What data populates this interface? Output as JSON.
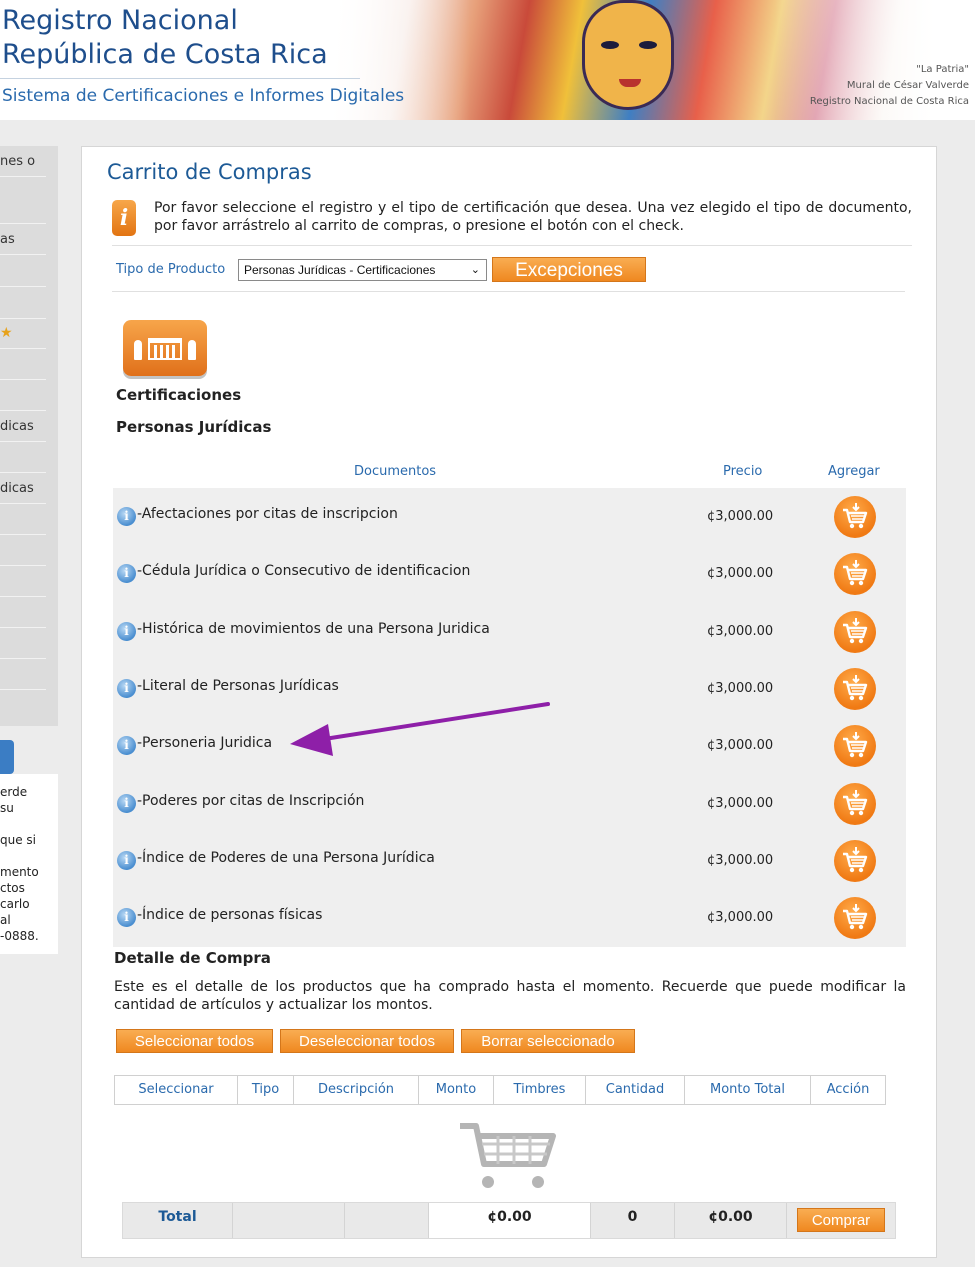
{
  "header": {
    "title_line1": "Registro Nacional",
    "title_line2": "República de Costa Rica",
    "subtitle": "Sistema de Certificaciones e Informes Digitales",
    "credit_line1": "\"La Patria\"",
    "credit_line2": "Mural de César Valverde",
    "credit_line3": "Registro Nacional de Costa Rica"
  },
  "sidebar": {
    "items": [
      "nes o",
      "",
      "as",
      "",
      "",
      "",
      "",
      "",
      "dicas",
      "",
      "dicas",
      "",
      "",
      "",
      "",
      "",
      ""
    ],
    "note_lines": [
      "erde",
      "su",
      "",
      "que si",
      "",
      "mento",
      "ctos",
      "carlo",
      "al",
      "-0888."
    ]
  },
  "main": {
    "title": "Carrito de Compras",
    "intro": "Por favor seleccione el registro y el tipo de certificación que desea. Una vez elegido el tipo de documento, por favor arrástrelo al carrito de compras, o presione el botón con el check.",
    "product_label": "Tipo de Producto",
    "product_selected": "Personas Jurídicas - Certificaciones",
    "exceptions_button": "Excepciones",
    "category_title": "Certificaciones",
    "category_subtitle": "Personas Jurídicas"
  },
  "documents": {
    "col_documentos": "Documentos",
    "col_precio": "Precio",
    "col_agregar": "Agregar",
    "rows": [
      {
        "name": "-Afectaciones por citas de inscripcion",
        "price": "¢3,000.00"
      },
      {
        "name": "-Cédula Jurídica o Consecutivo de identificacion",
        "price": "¢3,000.00"
      },
      {
        "name": "-Histórica de movimientos de una Persona Juridica",
        "price": "¢3,000.00"
      },
      {
        "name": "-Literal de Personas Jurídicas",
        "price": "¢3,000.00"
      },
      {
        "name": "-Personeria Juridica",
        "price": "¢3,000.00"
      },
      {
        "name": "-Poderes por citas de Inscripción",
        "price": "¢3,000.00"
      },
      {
        "name": "-Índice de Poderes de una Persona Jurídica",
        "price": "¢3,000.00"
      },
      {
        "name": "-Índice de personas físicas",
        "price": "¢3,000.00"
      }
    ]
  },
  "detail": {
    "title": "Detalle de Compra",
    "text": "Este es el detalle de los productos que ha comprado hasta el momento. Recuerde que puede modificar la cantidad de artículos y actualizar los montos.",
    "btn_select_all": "Seleccionar todos",
    "btn_deselect_all": "Deseleccionar todos",
    "btn_delete_selected": "Borrar seleccionado",
    "columns": [
      "Seleccionar",
      "Tipo",
      "Descripción",
      "Monto",
      "Timbres",
      "Cantidad",
      "Monto Total",
      "Acción"
    ]
  },
  "totals": {
    "label": "Total",
    "monto": "¢0.00",
    "cantidad": "0",
    "monto_total": "¢0.00",
    "buy_button": "Comprar"
  },
  "colors": {
    "accent_orange": "#ef8820",
    "link_blue": "#2a6aad",
    "annotation_arrow": "#8e1fa8"
  }
}
